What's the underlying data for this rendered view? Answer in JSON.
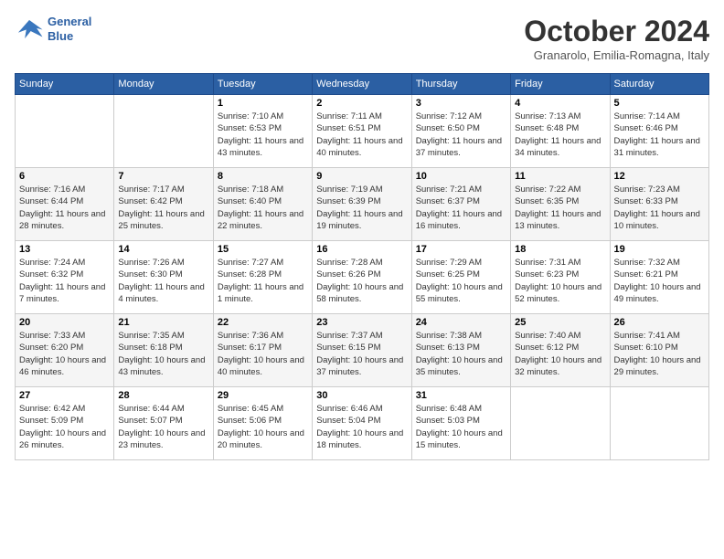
{
  "header": {
    "logo_line1": "General",
    "logo_line2": "Blue",
    "month": "October 2024",
    "location": "Granarolo, Emilia-Romagna, Italy"
  },
  "weekdays": [
    "Sunday",
    "Monday",
    "Tuesday",
    "Wednesday",
    "Thursday",
    "Friday",
    "Saturday"
  ],
  "weeks": [
    [
      {
        "day": "",
        "info": ""
      },
      {
        "day": "",
        "info": ""
      },
      {
        "day": "1",
        "info": "Sunrise: 7:10 AM\nSunset: 6:53 PM\nDaylight: 11 hours and 43 minutes."
      },
      {
        "day": "2",
        "info": "Sunrise: 7:11 AM\nSunset: 6:51 PM\nDaylight: 11 hours and 40 minutes."
      },
      {
        "day": "3",
        "info": "Sunrise: 7:12 AM\nSunset: 6:50 PM\nDaylight: 11 hours and 37 minutes."
      },
      {
        "day": "4",
        "info": "Sunrise: 7:13 AM\nSunset: 6:48 PM\nDaylight: 11 hours and 34 minutes."
      },
      {
        "day": "5",
        "info": "Sunrise: 7:14 AM\nSunset: 6:46 PM\nDaylight: 11 hours and 31 minutes."
      }
    ],
    [
      {
        "day": "6",
        "info": "Sunrise: 7:16 AM\nSunset: 6:44 PM\nDaylight: 11 hours and 28 minutes."
      },
      {
        "day": "7",
        "info": "Sunrise: 7:17 AM\nSunset: 6:42 PM\nDaylight: 11 hours and 25 minutes."
      },
      {
        "day": "8",
        "info": "Sunrise: 7:18 AM\nSunset: 6:40 PM\nDaylight: 11 hours and 22 minutes."
      },
      {
        "day": "9",
        "info": "Sunrise: 7:19 AM\nSunset: 6:39 PM\nDaylight: 11 hours and 19 minutes."
      },
      {
        "day": "10",
        "info": "Sunrise: 7:21 AM\nSunset: 6:37 PM\nDaylight: 11 hours and 16 minutes."
      },
      {
        "day": "11",
        "info": "Sunrise: 7:22 AM\nSunset: 6:35 PM\nDaylight: 11 hours and 13 minutes."
      },
      {
        "day": "12",
        "info": "Sunrise: 7:23 AM\nSunset: 6:33 PM\nDaylight: 11 hours and 10 minutes."
      }
    ],
    [
      {
        "day": "13",
        "info": "Sunrise: 7:24 AM\nSunset: 6:32 PM\nDaylight: 11 hours and 7 minutes."
      },
      {
        "day": "14",
        "info": "Sunrise: 7:26 AM\nSunset: 6:30 PM\nDaylight: 11 hours and 4 minutes."
      },
      {
        "day": "15",
        "info": "Sunrise: 7:27 AM\nSunset: 6:28 PM\nDaylight: 11 hours and 1 minute."
      },
      {
        "day": "16",
        "info": "Sunrise: 7:28 AM\nSunset: 6:26 PM\nDaylight: 10 hours and 58 minutes."
      },
      {
        "day": "17",
        "info": "Sunrise: 7:29 AM\nSunset: 6:25 PM\nDaylight: 10 hours and 55 minutes."
      },
      {
        "day": "18",
        "info": "Sunrise: 7:31 AM\nSunset: 6:23 PM\nDaylight: 10 hours and 52 minutes."
      },
      {
        "day": "19",
        "info": "Sunrise: 7:32 AM\nSunset: 6:21 PM\nDaylight: 10 hours and 49 minutes."
      }
    ],
    [
      {
        "day": "20",
        "info": "Sunrise: 7:33 AM\nSunset: 6:20 PM\nDaylight: 10 hours and 46 minutes."
      },
      {
        "day": "21",
        "info": "Sunrise: 7:35 AM\nSunset: 6:18 PM\nDaylight: 10 hours and 43 minutes."
      },
      {
        "day": "22",
        "info": "Sunrise: 7:36 AM\nSunset: 6:17 PM\nDaylight: 10 hours and 40 minutes."
      },
      {
        "day": "23",
        "info": "Sunrise: 7:37 AM\nSunset: 6:15 PM\nDaylight: 10 hours and 37 minutes."
      },
      {
        "day": "24",
        "info": "Sunrise: 7:38 AM\nSunset: 6:13 PM\nDaylight: 10 hours and 35 minutes."
      },
      {
        "day": "25",
        "info": "Sunrise: 7:40 AM\nSunset: 6:12 PM\nDaylight: 10 hours and 32 minutes."
      },
      {
        "day": "26",
        "info": "Sunrise: 7:41 AM\nSunset: 6:10 PM\nDaylight: 10 hours and 29 minutes."
      }
    ],
    [
      {
        "day": "27",
        "info": "Sunrise: 6:42 AM\nSunset: 5:09 PM\nDaylight: 10 hours and 26 minutes."
      },
      {
        "day": "28",
        "info": "Sunrise: 6:44 AM\nSunset: 5:07 PM\nDaylight: 10 hours and 23 minutes."
      },
      {
        "day": "29",
        "info": "Sunrise: 6:45 AM\nSunset: 5:06 PM\nDaylight: 10 hours and 20 minutes."
      },
      {
        "day": "30",
        "info": "Sunrise: 6:46 AM\nSunset: 5:04 PM\nDaylight: 10 hours and 18 minutes."
      },
      {
        "day": "31",
        "info": "Sunrise: 6:48 AM\nSunset: 5:03 PM\nDaylight: 10 hours and 15 minutes."
      },
      {
        "day": "",
        "info": ""
      },
      {
        "day": "",
        "info": ""
      }
    ]
  ]
}
